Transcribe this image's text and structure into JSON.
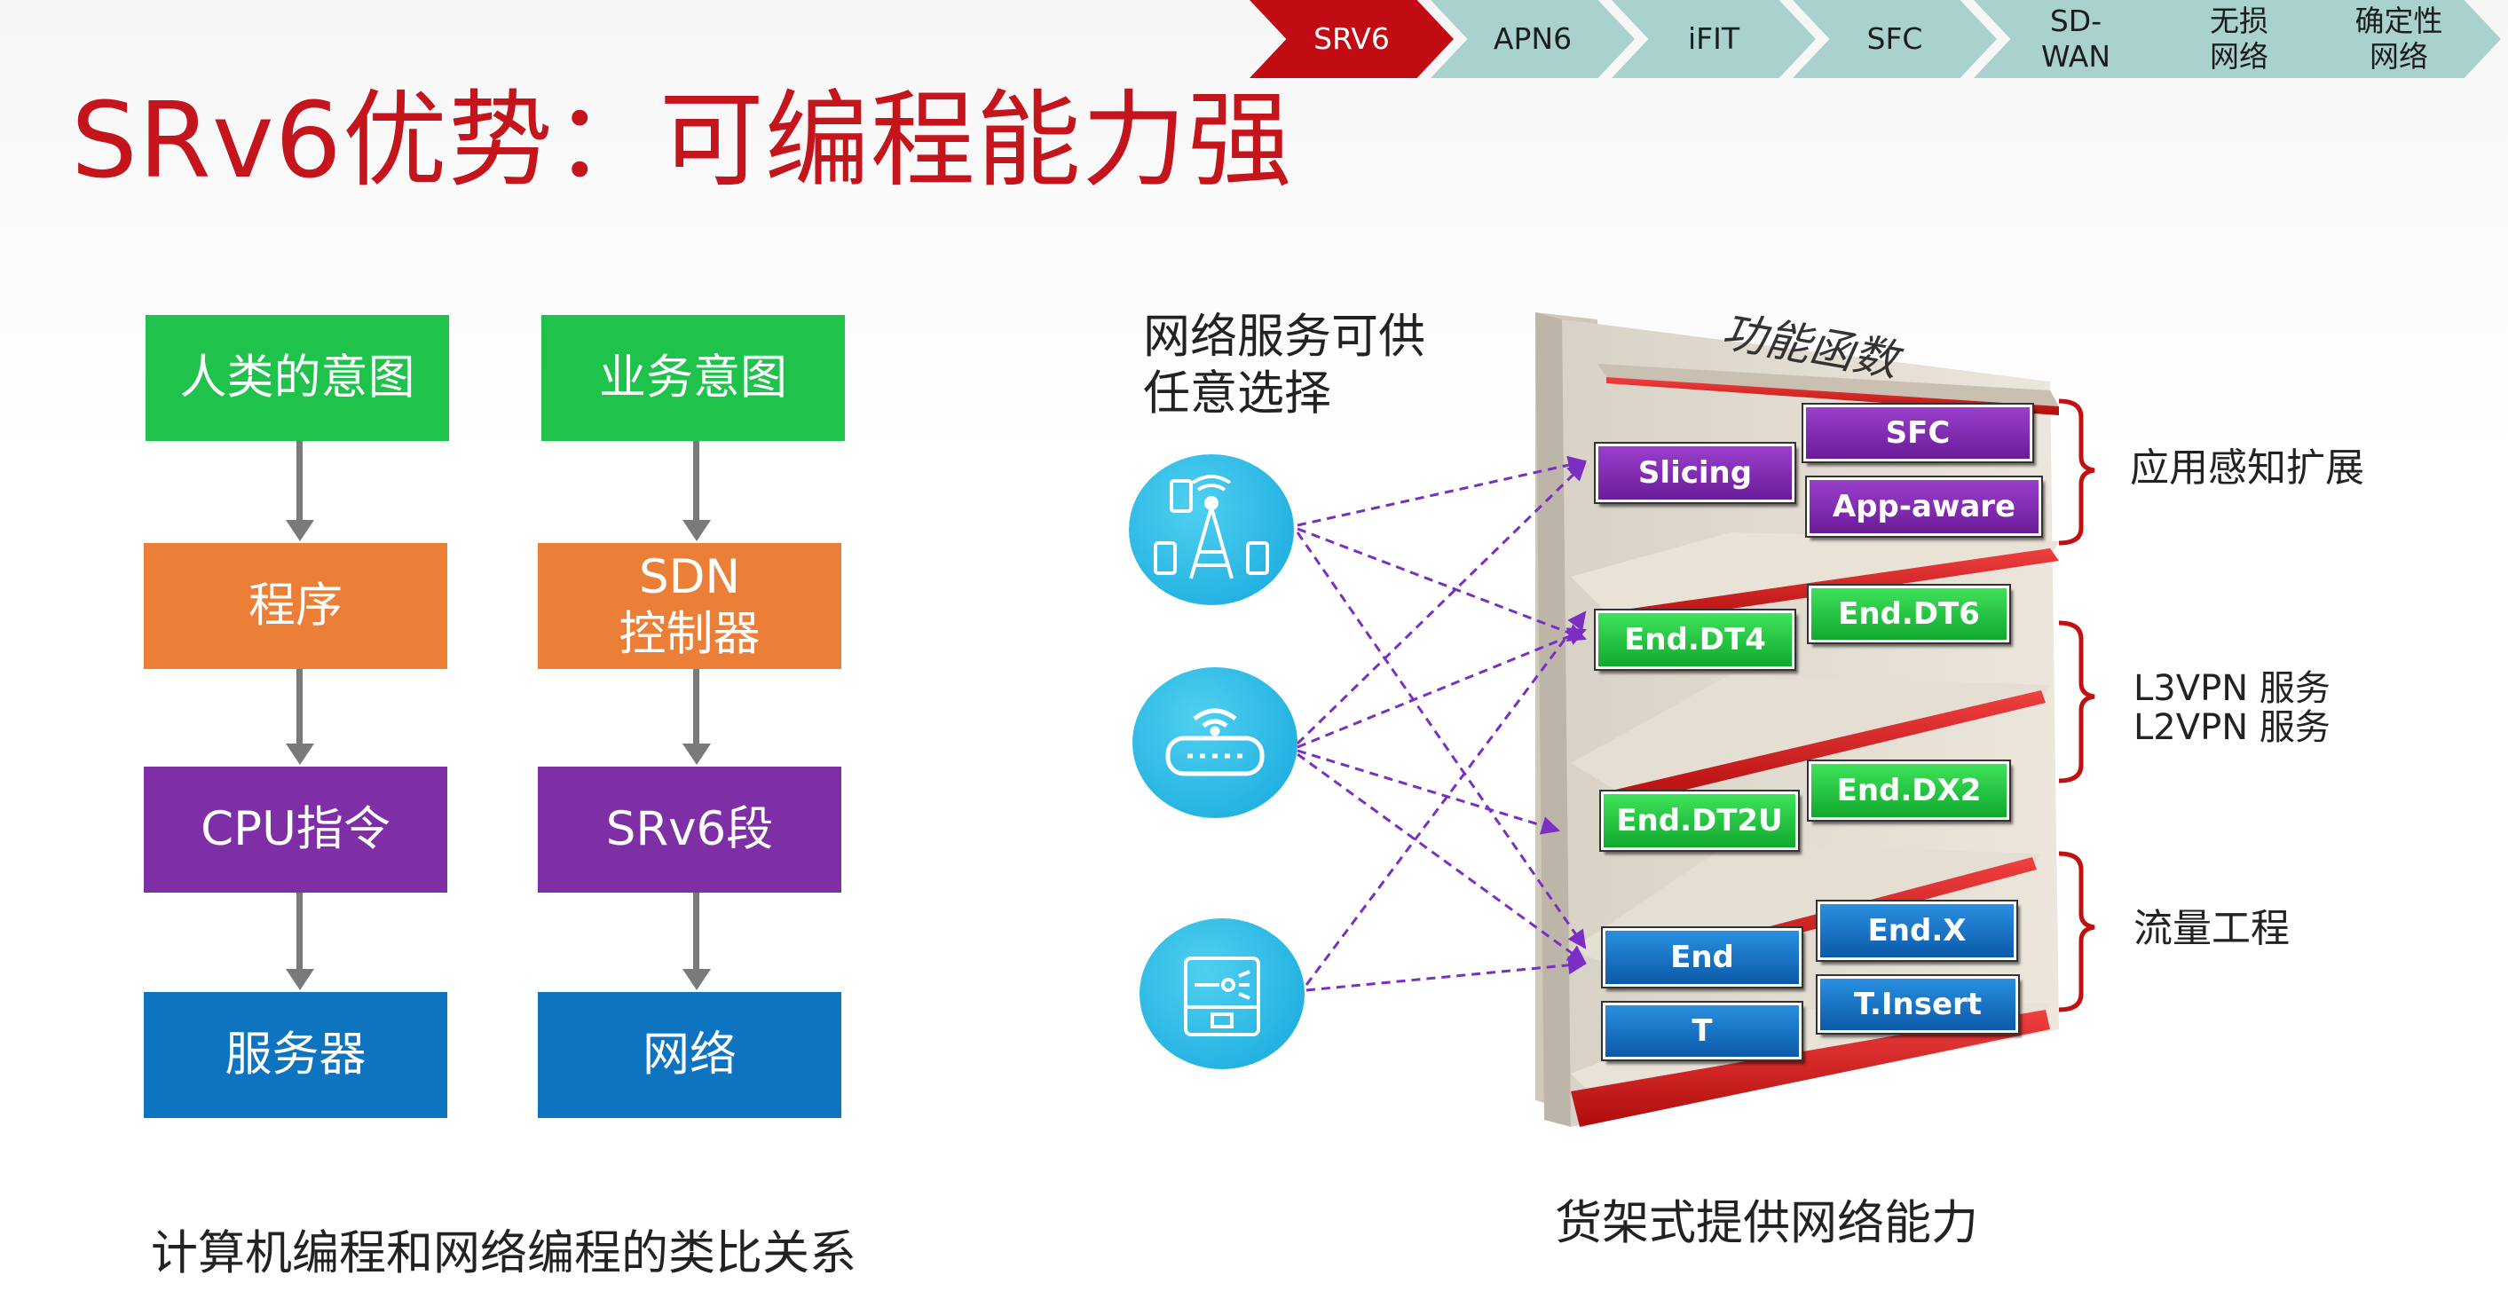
{
  "nav": {
    "items": [
      "SRV6",
      "APN6",
      "iFIT",
      "SFC",
      "SD-\nWAN",
      "无损\n网络",
      "确定性\n网络"
    ],
    "active_index": 0
  },
  "title": "SRv6优势：可编程能力强",
  "left_diagram": {
    "col1": [
      "人类的意图",
      "程序",
      "CPU指令",
      "服务器"
    ],
    "col2": [
      "业务意图",
      "SDN\n控制器",
      "SRv6段",
      "网络"
    ],
    "caption": "计算机编程和网络编程的类比关系"
  },
  "right_diagram": {
    "heading": "网络服务可供\n任意选择",
    "shelf_label": "功能函数",
    "functions": {
      "slicing": "Slicing",
      "sfc": "SFC",
      "app_aware": "App-aware",
      "end_dt4": "End.DT4",
      "end_dt6": "End.DT6",
      "end_dt2u": "End.DT2U",
      "end_dx2": "End.DX2",
      "end": "End",
      "end_x": "End.X",
      "t": "T",
      "t_insert": "T.Insert"
    },
    "groups": {
      "app": "应用感知扩展",
      "vpn": "L3VPN 服务\nL2VPN 服务",
      "te": "流量工程"
    },
    "caption": "货架式提供网络能力"
  },
  "colors": {
    "title_red": "#c4141c",
    "nav_active": "#c00c12",
    "nav_inactive": "#a9d2cf",
    "green": "#1fc24b",
    "orange": "#eb7f37",
    "purple": "#7f2fa5",
    "blue": "#0f74bf"
  }
}
